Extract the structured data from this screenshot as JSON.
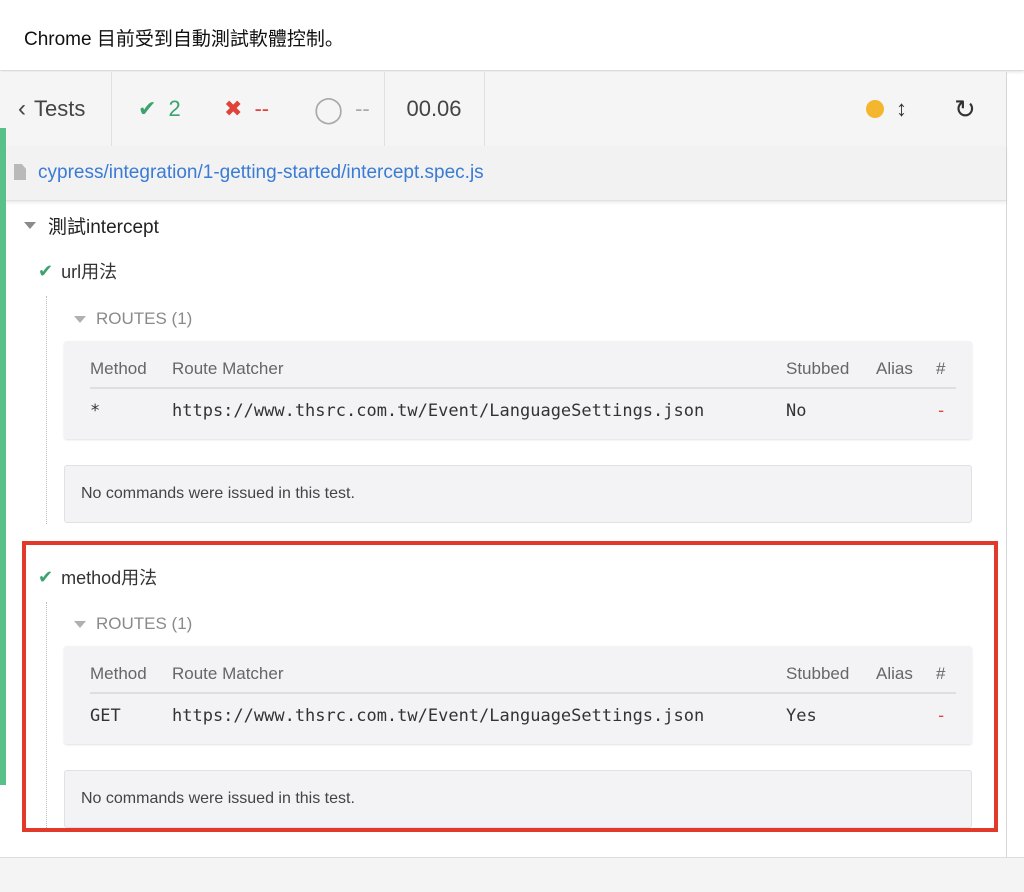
{
  "banner": {
    "text": "Chrome 目前受到自動測試軟體控制。"
  },
  "header": {
    "tests_label": "Tests",
    "passed": "2",
    "failed": "--",
    "pending": "--",
    "duration": "00.06",
    "status_color": "#f3b62e"
  },
  "spec": {
    "path": "cypress/integration/1-getting-started/intercept.spec.js"
  },
  "suite": {
    "title": "測試intercept"
  },
  "tests": [
    {
      "title": "url用法",
      "routes_label": "ROUTES (1)",
      "columns": [
        "Method",
        "Route Matcher",
        "Stubbed",
        "Alias",
        "#"
      ],
      "route": {
        "method": "*",
        "matcher": "https://www.thsrc.com.tw/Event/LanguageSettings.json",
        "stubbed": "No",
        "alias": "",
        "count": "-"
      },
      "commands_text": "No commands were issued in this test."
    },
    {
      "title": "method用法",
      "routes_label": "ROUTES (1)",
      "columns": [
        "Method",
        "Route Matcher",
        "Stubbed",
        "Alias",
        "#"
      ],
      "route": {
        "method": "GET",
        "matcher": "https://www.thsrc.com.tw/Event/LanguageSettings.json",
        "stubbed": "Yes",
        "alias": "",
        "count": "-"
      },
      "commands_text": "No commands were issued in this test."
    }
  ],
  "colors": {
    "pass": "#3da36e",
    "fail": "#e0433a",
    "link": "#3a7bd5",
    "highlight": "#e23a2a"
  }
}
